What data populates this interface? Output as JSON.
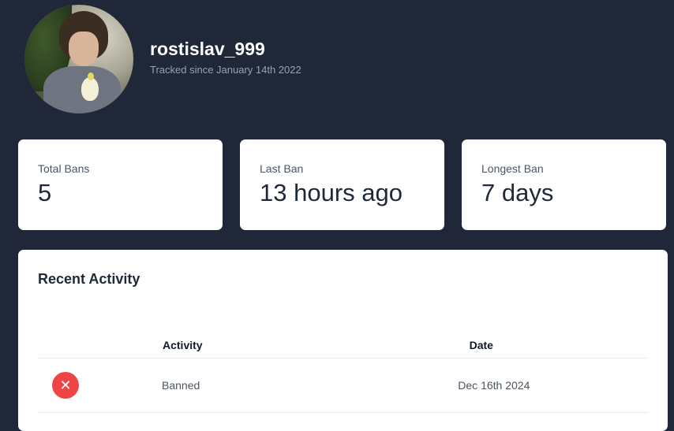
{
  "profile": {
    "username": "rostislav_999",
    "tracked_since": "Tracked since January 14th 2022"
  },
  "stats": [
    {
      "label": "Total Bans",
      "value": "5"
    },
    {
      "label": "Last Ban",
      "value": "13 hours ago"
    },
    {
      "label": "Longest Ban",
      "value": "7 days"
    }
  ],
  "activity": {
    "title": "Recent Activity",
    "columns": [
      "Activity",
      "Date"
    ],
    "rows": [
      {
        "icon": "close-icon",
        "status_glyph": "✕",
        "activity": "Banned",
        "date": "Dec 16th 2024"
      }
    ]
  },
  "colors": {
    "background": "#1f2738",
    "card": "#ffffff",
    "banned_icon": "#ef4444"
  }
}
